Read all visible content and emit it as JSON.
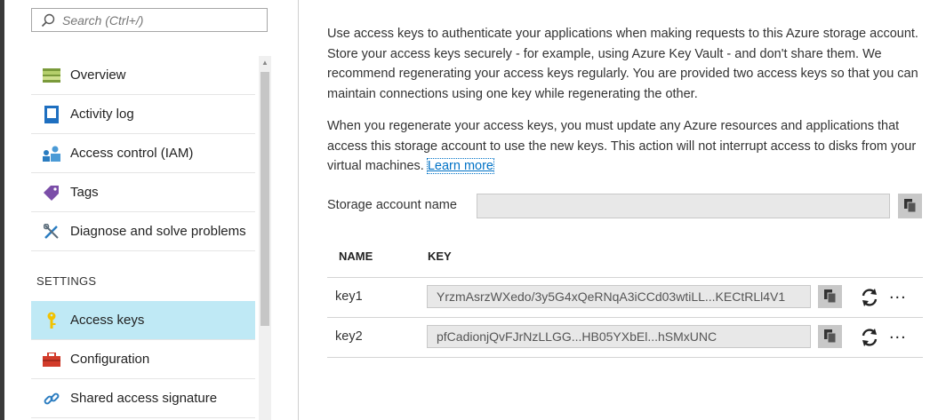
{
  "search": {
    "placeholder": "Search (Ctrl+/)"
  },
  "sidebar": {
    "items_top": [
      {
        "label": "Overview",
        "icon": "overview-icon"
      },
      {
        "label": "Activity log",
        "icon": "activity-log-icon"
      },
      {
        "label": "Access control (IAM)",
        "icon": "iam-icon"
      },
      {
        "label": "Tags",
        "icon": "tag-icon"
      },
      {
        "label": "Diagnose and solve problems",
        "icon": "wrench-icon"
      }
    ],
    "section_settings": "SETTINGS",
    "items_settings": [
      {
        "label": "Access keys",
        "icon": "key-icon",
        "selected": true
      },
      {
        "label": "Configuration",
        "icon": "toolbox-icon"
      },
      {
        "label": "Shared access signature",
        "icon": "link-icon"
      }
    ]
  },
  "main": {
    "paragraph1": "Use access keys to authenticate your applications when making requests to this Azure storage account. Store your access keys securely - for example, using Azure Key Vault - and don't share them. We recommend regenerating your access keys regularly. You are provided two access keys so that you can maintain connections using one key while regenerating the other.",
    "paragraph2": "When you regenerate your access keys, you must update any Azure resources and applications that access this storage account to use the new keys. This action will not interrupt access to disks from your virtual machines.",
    "learn_more": "Learn more",
    "account_label": "Storage account name",
    "account_value": "",
    "table": {
      "col_name": "NAME",
      "col_key": "KEY",
      "rows": [
        {
          "name": "key1",
          "value": "YrzmAsrzWXedo/3y5G4xQeRNqA3iCCd03wtiLL...KECtRLl4V1"
        },
        {
          "name": "key2",
          "value": "pfCadionjQvFJrNzLLGG...HB05YXbEl...hSMxUNC"
        }
      ],
      "more_label": "..."
    }
  },
  "colors": {
    "selected_bg": "#bfe9f5",
    "link": "#0072c6",
    "copy_button_bg": "#c8c8c8"
  }
}
